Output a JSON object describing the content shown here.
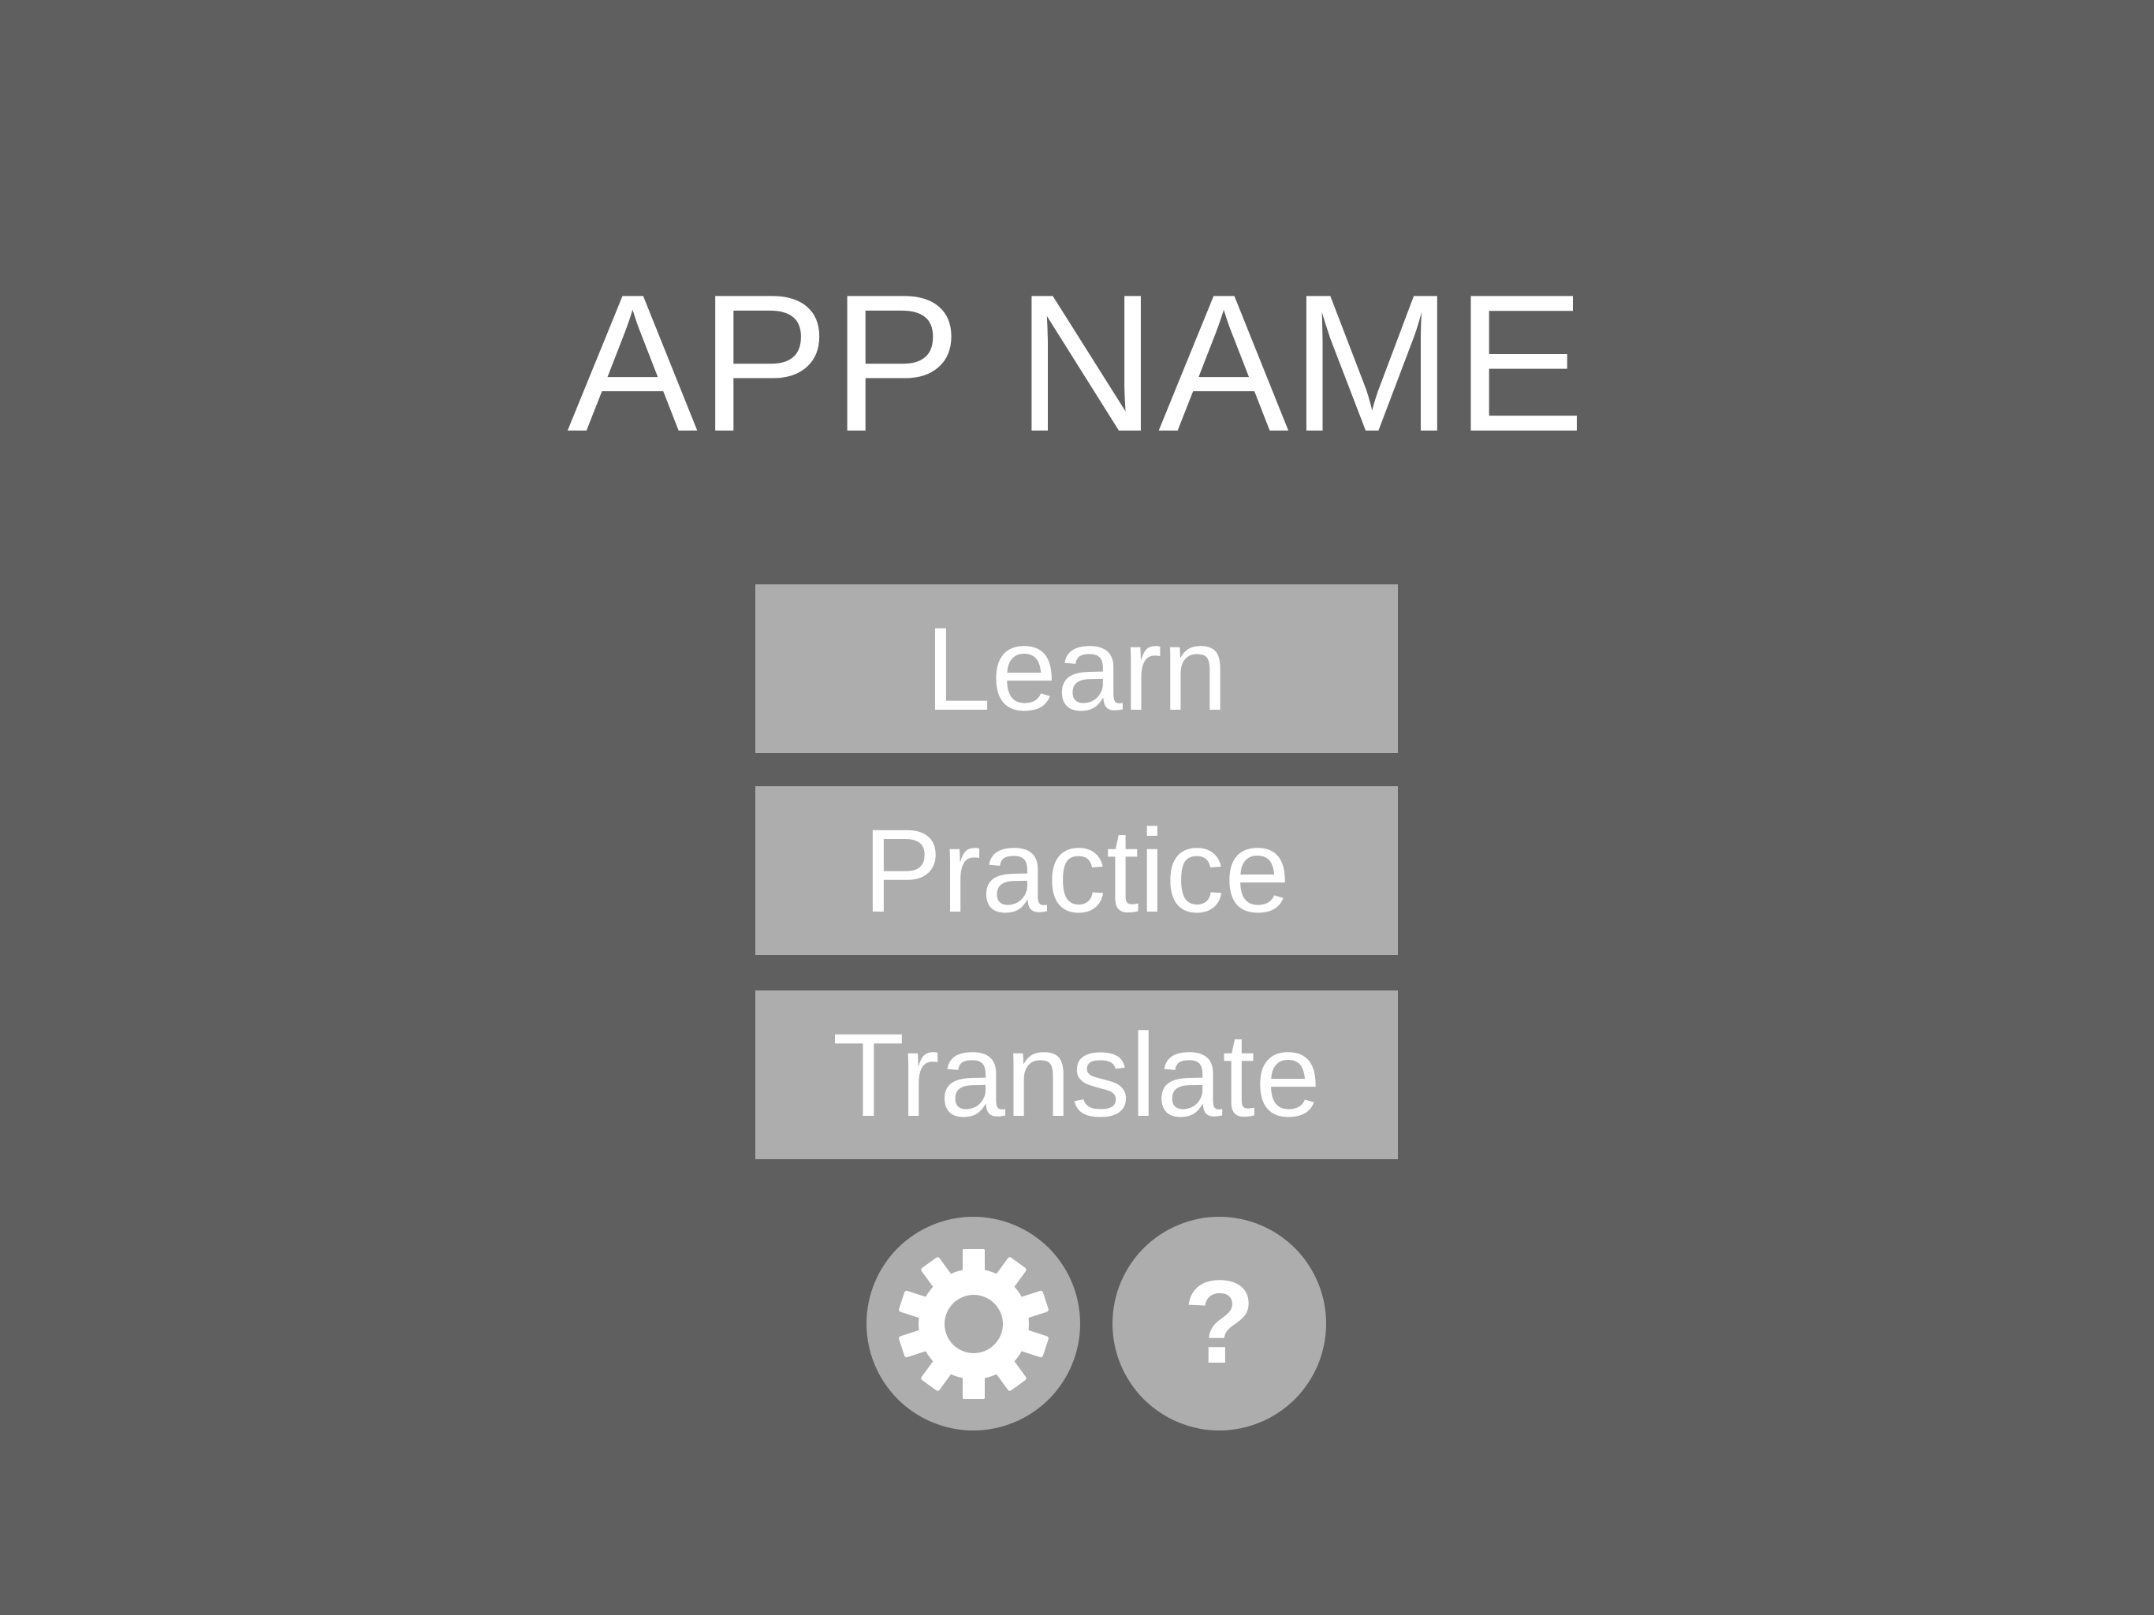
{
  "header": {
    "title": "APP NAME"
  },
  "menu": {
    "buttons": [
      {
        "label": "Learn"
      },
      {
        "label": "Practice"
      },
      {
        "label": "Translate"
      }
    ]
  },
  "footer": {
    "settings_icon": "gear-icon",
    "help_label": "?"
  },
  "colors": {
    "background": "#5f5f5f",
    "button": "#adadad",
    "text": "#ffffff"
  }
}
